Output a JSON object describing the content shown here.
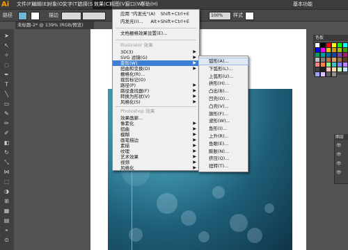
{
  "app": {
    "logo": "Ai"
  },
  "menubar": {
    "items": [
      "文件(F)",
      "编辑(E)",
      "对象(O)",
      "文字(T)",
      "选择(S)",
      "效果(C)",
      "视图(V)",
      "窗口(W)",
      "帮助(H)"
    ],
    "active_index": 5,
    "right_label": "基本功能"
  },
  "controlbar": {
    "path_label": "路径",
    "stroke_label": "描边",
    "zoom": "100%",
    "style_label": "样式"
  },
  "document_tab": {
    "title": "未标题-2* @ 139% (RGB/预览)"
  },
  "effect_menu": {
    "top_items": [
      {
        "label": "应用 \"内发光\"(A)",
        "shortcut": "Shift+Ctrl+E"
      },
      {
        "label": "内发光(I)...",
        "shortcut": "Alt+Shift+Ctrl+E"
      }
    ],
    "raster_settings": "文档栅格效果设置(E)...",
    "illustrator_header": "Illustrator 效果",
    "illustrator_items": [
      "3D(3)",
      "SVG 滤镜(G)",
      "变形(W)",
      "扭曲和变换(D)",
      "栅格化(R)...",
      "裁剪标记(O)",
      "路径(P)",
      "路径查找器(F)",
      "转换为形状(V)",
      "风格化(S)"
    ],
    "highlighted_index": 2,
    "photoshop_header": "Photoshop 效果",
    "photoshop_items": [
      "效果画廊...",
      "像素化",
      "扭曲",
      "模糊",
      "画笔描边",
      "素描",
      "纹理",
      "艺术效果",
      "视频",
      "风格化"
    ]
  },
  "warp_submenu": {
    "items": [
      "弧形(A)...",
      "下弧形(L)...",
      "上弧形(U)...",
      "拱形(H)...",
      "凸出(B)...",
      "凹壳(O)...",
      "凸壳(V)...",
      "旗形(F)...",
      "波形(W)...",
      "鱼形(I)...",
      "上升(R)...",
      "鱼眼(E)...",
      "膨胀(N)...",
      "挤压(Q)...",
      "扭转(T)..."
    ]
  },
  "swatches_panel": {
    "title": "色板",
    "colors": [
      "#ffffff",
      "#000000",
      "#ff0000",
      "#ffff00",
      "#00ff00",
      "#00ffff",
      "#0000ff",
      "#ff00ff",
      "#e6c200",
      "#c8a000",
      "#a0c800",
      "#40a000",
      "#00a060",
      "#00a0a0",
      "#006aa0",
      "#2040a0",
      "#8040a0",
      "#a0206a",
      "#c0c0c0",
      "#808080",
      "#c87040",
      "#e0a060",
      "#a07040",
      "#604020",
      "#ff8080",
      "#ff8040",
      "#80ff80",
      "#40c0c0",
      "#8080ff",
      "#c080ff",
      "#404040",
      "#202020",
      "#ffc0c0",
      "#ffe0a0",
      "#c0ffc0",
      "#c0e0ff",
      "#a0a0ff",
      "#e0c0ff",
      "#606060",
      "#909090"
    ]
  },
  "layers_panel": {
    "title": "图层"
  }
}
